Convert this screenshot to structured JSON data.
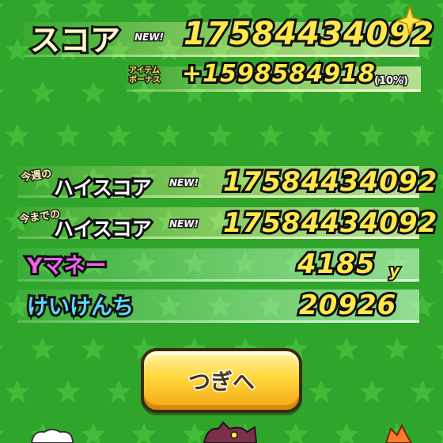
{
  "score": {
    "label": "スコア",
    "new_tag": "NEW!",
    "value": "17584434092"
  },
  "item_bonus": {
    "label_line1": "アイテム",
    "label_line2": "ボーナス",
    "value": "+1598584918",
    "percent": "(10%)"
  },
  "weekly_high": {
    "prefix": "今週の",
    "label": "ハイスコア",
    "new_tag": "NEW!",
    "value": "17584434092"
  },
  "alltime_high": {
    "prefix": "今までの",
    "label": "ハイスコア",
    "new_tag": "NEW!",
    "value": "17584434092"
  },
  "money": {
    "label": "Yマネー",
    "value": "4185",
    "unit": "y"
  },
  "exp": {
    "label": "けいけんち",
    "value": "20926"
  },
  "next_button": {
    "label": "つぎへ"
  },
  "colors": {
    "background": "#2fa52b",
    "star": "#49c43e",
    "number": "#ffe84a",
    "money_label": "#f060f0",
    "exp_label": "#5ed8ff",
    "button": "#ffd83a"
  }
}
